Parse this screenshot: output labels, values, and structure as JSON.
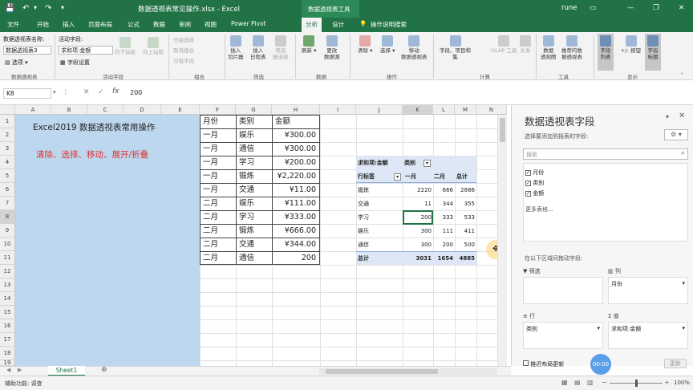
{
  "title_bar": {
    "filename": "数据透视表常见操作.xlsx - Excel",
    "tool_tab": "数据透视表工具",
    "user": "rune"
  },
  "ribbon_tabs": [
    "文件",
    "开始",
    "插入",
    "页面布局",
    "公式",
    "数据",
    "审阅",
    "视图",
    "Power Pivot",
    "分析",
    "设计"
  ],
  "tell_me": "操作说明搜索",
  "ribbon": {
    "pivot_name_label": "数据透视表名称:",
    "pivot_name_value": "数据透视表3",
    "options_label": "选项",
    "active_field_label": "活动字段:",
    "active_field_value": "求和项:金额",
    "field_settings_label": "字段设置",
    "drill_down": "向下钻取",
    "drill_up": "向上钻取",
    "group_selection": "分组选择",
    "ungroup": "取消组合",
    "group_field": "分组字段",
    "insert_slicer": "插入\n切片器",
    "insert_timeline": "插入\n日程表",
    "filter_connections": "筛选\n器连接",
    "refresh": "刷新",
    "change_source": "更改\n数据源",
    "clear": "清除",
    "select": "选择",
    "move_pivot": "移动\n数据透视表",
    "fields_items": "字段、项目和\n集",
    "olap": "OLAP 工具",
    "relationships": "关系",
    "pivot_chart": "数据\n透视图",
    "recommended": "推荐的数\n据透视表",
    "field_list": "字段\n列表",
    "plus_minus": "+/- 按钮",
    "field_headers": "字段\n标题",
    "groups": [
      "数据透视表",
      "活动字段",
      "组合",
      "筛选",
      "数据",
      "操作",
      "计算",
      "工具",
      "显示"
    ]
  },
  "name_box": "K8",
  "formula_value": "200",
  "columns": [
    "A",
    "B",
    "C",
    "D",
    "E",
    "F",
    "G",
    "H",
    "I",
    "J",
    "K",
    "L",
    "M",
    "N"
  ],
  "rows": [
    "1",
    "2",
    "3",
    "4",
    "5",
    "6",
    "7",
    "8",
    "9",
    "10",
    "11",
    "12",
    "13",
    "14",
    "15",
    "16",
    "17",
    "18",
    "19"
  ],
  "title_text": "Excel2019 数据透视表常用操作",
  "subtitle_text": "清除、选择、移动、展开/折叠",
  "table": {
    "headers": [
      "月份",
      "类别",
      "金额"
    ],
    "rows": [
      [
        "一月",
        "娱乐",
        "¥300.00"
      ],
      [
        "一月",
        "通信",
        "¥300.00"
      ],
      [
        "一月",
        "学习",
        "¥200.00"
      ],
      [
        "一月",
        "锻炼",
        "¥2,220.00"
      ],
      [
        "一月",
        "交通",
        "¥11.00"
      ],
      [
        "二月",
        "娱乐",
        "¥111.00"
      ],
      [
        "二月",
        "学习",
        "¥333.00"
      ],
      [
        "二月",
        "锻炼",
        "¥666.00"
      ],
      [
        "二月",
        "交通",
        "¥344.00"
      ],
      [
        "二月",
        "通信",
        "200"
      ]
    ]
  },
  "pivot": {
    "values_label": "求和项:金额",
    "col_label": "类别",
    "row_label": "行标签",
    "col_headers": [
      "一月",
      "二月",
      "总计"
    ],
    "rows": [
      [
        "锻炼",
        "2220",
        "666",
        "2886"
      ],
      [
        "交通",
        "11",
        "344",
        "355"
      ],
      [
        "学习",
        "200",
        "333",
        "533"
      ],
      [
        "娱乐",
        "300",
        "111",
        "411"
      ],
      [
        "通信",
        "300",
        "200",
        "500"
      ]
    ],
    "total": [
      "总计",
      "3031",
      "1654",
      "4885"
    ]
  },
  "field_list": {
    "title": "数据透视表字段",
    "choose_label": "选择要添加到报表的字段:",
    "search_placeholder": "搜索",
    "fields": [
      "月份",
      "类别",
      "金额"
    ],
    "more_tables": "更多表格...",
    "drag_label": "在以下区域间拖动字段:",
    "filter_label": "筛选",
    "columns_label": "列",
    "rows_label": "行",
    "values_label": "值",
    "column_field": "月份",
    "row_field": "类别",
    "value_field": "求和项:金额",
    "defer_label": "推迟布局更新",
    "update_btn": "更新",
    "timer": "00:00"
  },
  "sheet_tab": "Sheet1",
  "status": {
    "accessibility": "辅助功能: 调查",
    "zoom": "100%"
  },
  "colors": {
    "excel_green": "#217346",
    "blue_fill": "#bdd7ee",
    "red_text": "#e03030",
    "pivot_header": "#dde7f5"
  }
}
